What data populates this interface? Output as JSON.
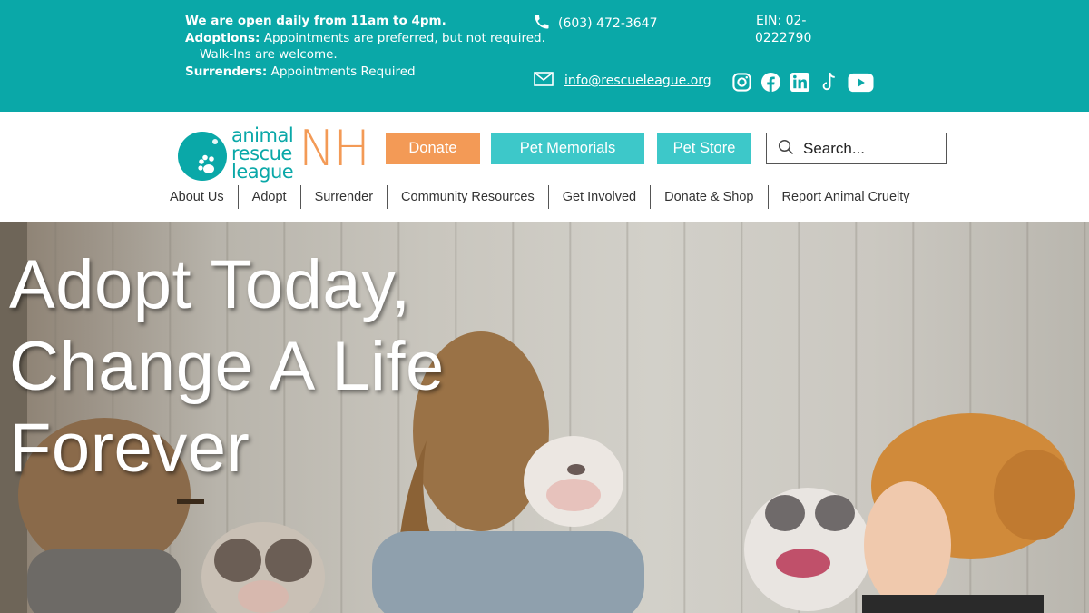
{
  "topbar": {
    "hours_line": "We are open daily from 11am to 4pm.",
    "adoptions_label": "Adoptions:",
    "adoptions_text": "Appointments are preferred, but not required.",
    "walkins_text": "Walk-Ins are welcome.",
    "surrenders_label": "Surrenders:",
    "surrenders_text": "Appointments Required",
    "phone": "(603) 472-3647",
    "ein_line1": "EIN: 02-",
    "ein_line2": "0222790",
    "email": "info@rescueleague.org",
    "social_icons": [
      "instagram-icon",
      "facebook-icon",
      "linkedin-icon",
      "tiktok-icon",
      "youtube-icon"
    ]
  },
  "logo": {
    "line1": "animal",
    "line2": "rescue",
    "line3": "league",
    "suffix": "NH"
  },
  "header": {
    "donate_label": "Donate",
    "memorials_label": "Pet Memorials",
    "store_label": "Pet Store",
    "search_placeholder": "Search..."
  },
  "nav": {
    "items": [
      "About Us",
      "Adopt",
      "Surrender",
      "Community Resources",
      "Get Involved",
      "Donate & Shop",
      "Report Animal Cruelty"
    ]
  },
  "hero": {
    "title_line1": "Adopt Today,",
    "title_line2": "Change A Life",
    "title_line3": "Forever"
  },
  "colors": {
    "teal": "#0aa8a8",
    "light_teal": "#3dc8c9",
    "orange": "#f39a56"
  }
}
